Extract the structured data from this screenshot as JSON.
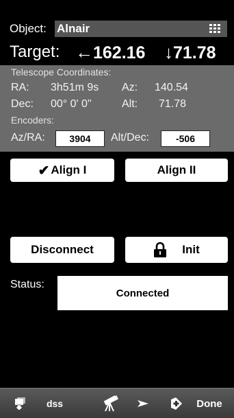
{
  "object": {
    "label": "Object:",
    "value": "Alnair"
  },
  "target": {
    "label": "Target:",
    "az_arrow": "←",
    "az_value": "162.16",
    "alt_arrow": "↓",
    "alt_value": "71.78"
  },
  "telescope": {
    "title": "Telescope Coordinates:",
    "ra_label": "RA:",
    "ra_value": "3h51m 9s",
    "az_label": "Az:",
    "az_value": "140.54",
    "dec_label": "Dec:",
    "dec_value": "00° 0' 0\"",
    "alt_label": "Alt:",
    "alt_value": "71.78"
  },
  "encoders": {
    "title": "Encoders:",
    "azra_label": "Az/RA:",
    "azra_value": "3904",
    "altdec_label": "Alt/Dec:",
    "altdec_value": "-506"
  },
  "buttons": {
    "align1_check": "✔",
    "align1": "Align I",
    "align2": "Align II",
    "disconnect": "Disconnect",
    "init": "Init"
  },
  "status": {
    "label": "Status:",
    "value": "Connected"
  },
  "toolbar": {
    "dss": "dss",
    "done": "Done"
  },
  "icons": [
    "grid-menu-icon",
    "lock-icon",
    "download-icon",
    "telescope-icon",
    "play-arrow-icon",
    "nav-add-icon"
  ]
}
